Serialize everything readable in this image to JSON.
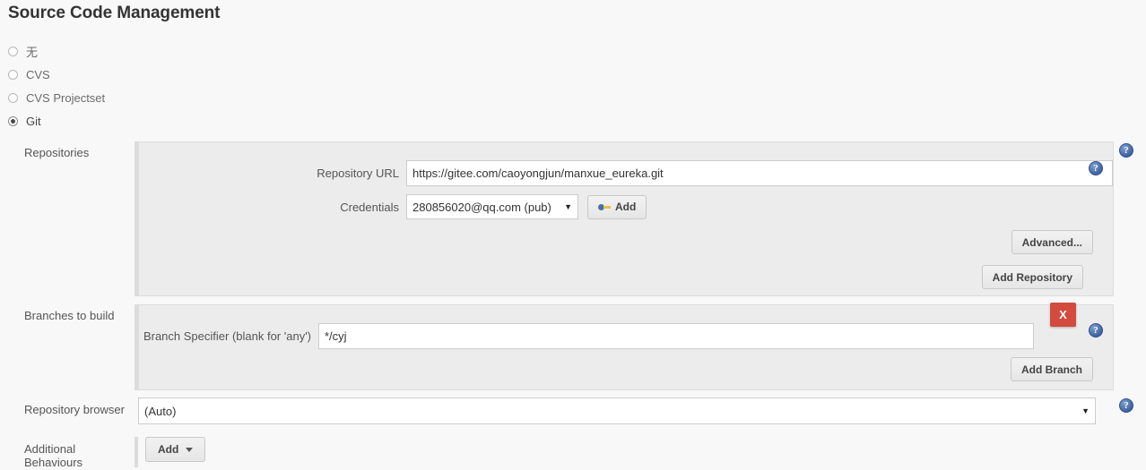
{
  "page": {
    "title": "Source Code Management"
  },
  "scm": {
    "options": [
      {
        "label": "无",
        "selected": false
      },
      {
        "label": "CVS",
        "selected": false
      },
      {
        "label": "CVS Projectset",
        "selected": false
      },
      {
        "label": "Git",
        "selected": true
      }
    ]
  },
  "repositories": {
    "section_label": "Repositories",
    "repository_url": {
      "label": "Repository URL",
      "value": "https://gitee.com/caoyongjun/manxue_eureka.git",
      "placeholder": ""
    },
    "credentials": {
      "label": "Credentials",
      "selected": "280856020@qq.com (pub)",
      "options": [
        "280856020@qq.com (pub)"
      ],
      "add_button": "Add",
      "add_button_icon": "key-icon"
    },
    "advanced_button": "Advanced...",
    "add_repository_button": "Add Repository",
    "help_icon": "help-icon"
  },
  "branches": {
    "section_label": "Branches to build",
    "branch_specifier": {
      "label": "Branch Specifier (blank for 'any')",
      "value": "*/cyj",
      "placeholder": ""
    },
    "delete_button": "X",
    "add_branch_button": "Add Branch",
    "help_icon": "help-icon"
  },
  "repository_browser": {
    "label": "Repository browser",
    "selected": "(Auto)",
    "options": [
      "(Auto)"
    ],
    "help_icon": "help-icon"
  },
  "additional_behaviours": {
    "label": "Additional Behaviours",
    "add_button": "Add"
  },
  "colors": {
    "accent_delete": "#d24b3e",
    "help_blue": "#3f639f",
    "panel_bg": "#ececec",
    "page_bg": "#f8f8f8"
  }
}
